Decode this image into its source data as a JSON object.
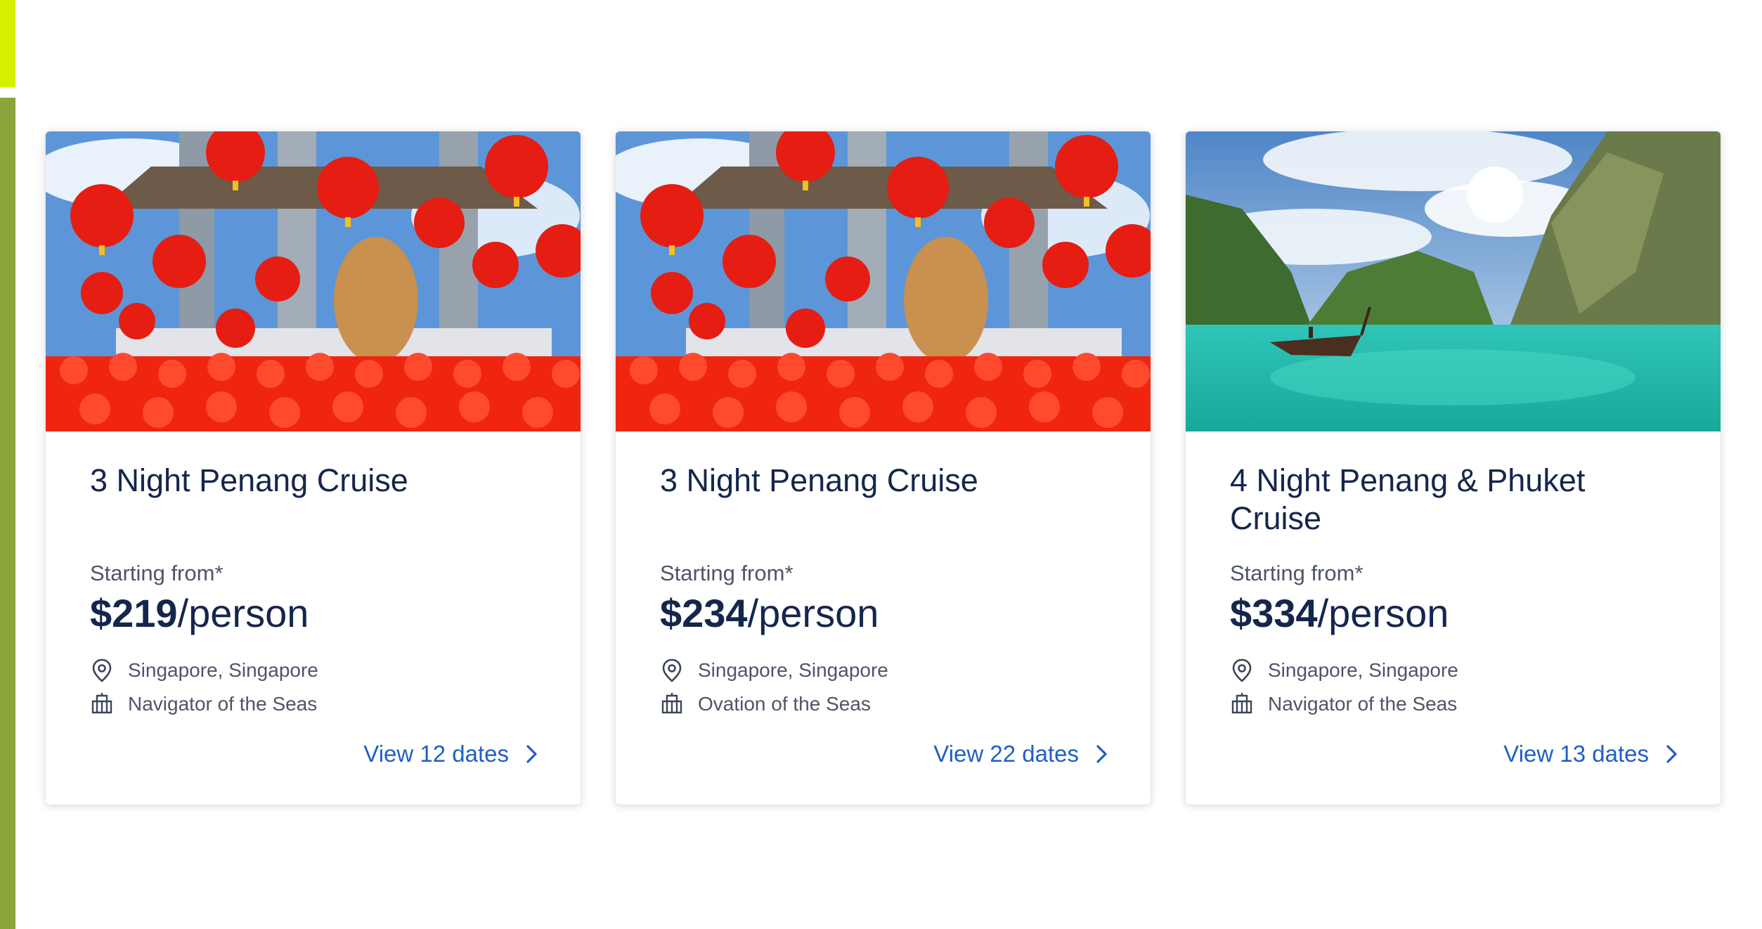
{
  "cards": [
    {
      "image": "penang-lanterns-temple",
      "title": "3 Night Penang Cruise",
      "from_label": "Starting from*",
      "price": "$219",
      "price_unit": "/person",
      "port_icon": "location-pin-icon",
      "port": "Singapore, Singapore",
      "ship_icon": "ship-icon",
      "ship": "Navigator of the Seas",
      "view_label": "View 12 dates"
    },
    {
      "image": "penang-lanterns-temple",
      "title": "3 Night Penang Cruise",
      "from_label": "Starting from*",
      "price": "$234",
      "price_unit": "/person",
      "port_icon": "location-pin-icon",
      "port": "Singapore, Singapore",
      "ship_icon": "ship-icon",
      "ship": "Ovation of the Seas",
      "view_label": "View 22 dates"
    },
    {
      "image": "phuket-lagoon-longtail-boat",
      "title": "4 Night Penang & Phuket Cruise",
      "from_label": "Starting from*",
      "price": "$334",
      "price_unit": "/person",
      "port_icon": "location-pin-icon",
      "port": "Singapore, Singapore",
      "ship_icon": "ship-icon",
      "ship": "Navigator of the Seas",
      "view_label": "View 13 dates"
    }
  ],
  "colors": {
    "accent_bar_top": "#d4f000",
    "accent_bar_main": "#8aa63a",
    "title": "#15264c",
    "link": "#1f5fc3",
    "meta_text": "#4e5567"
  }
}
